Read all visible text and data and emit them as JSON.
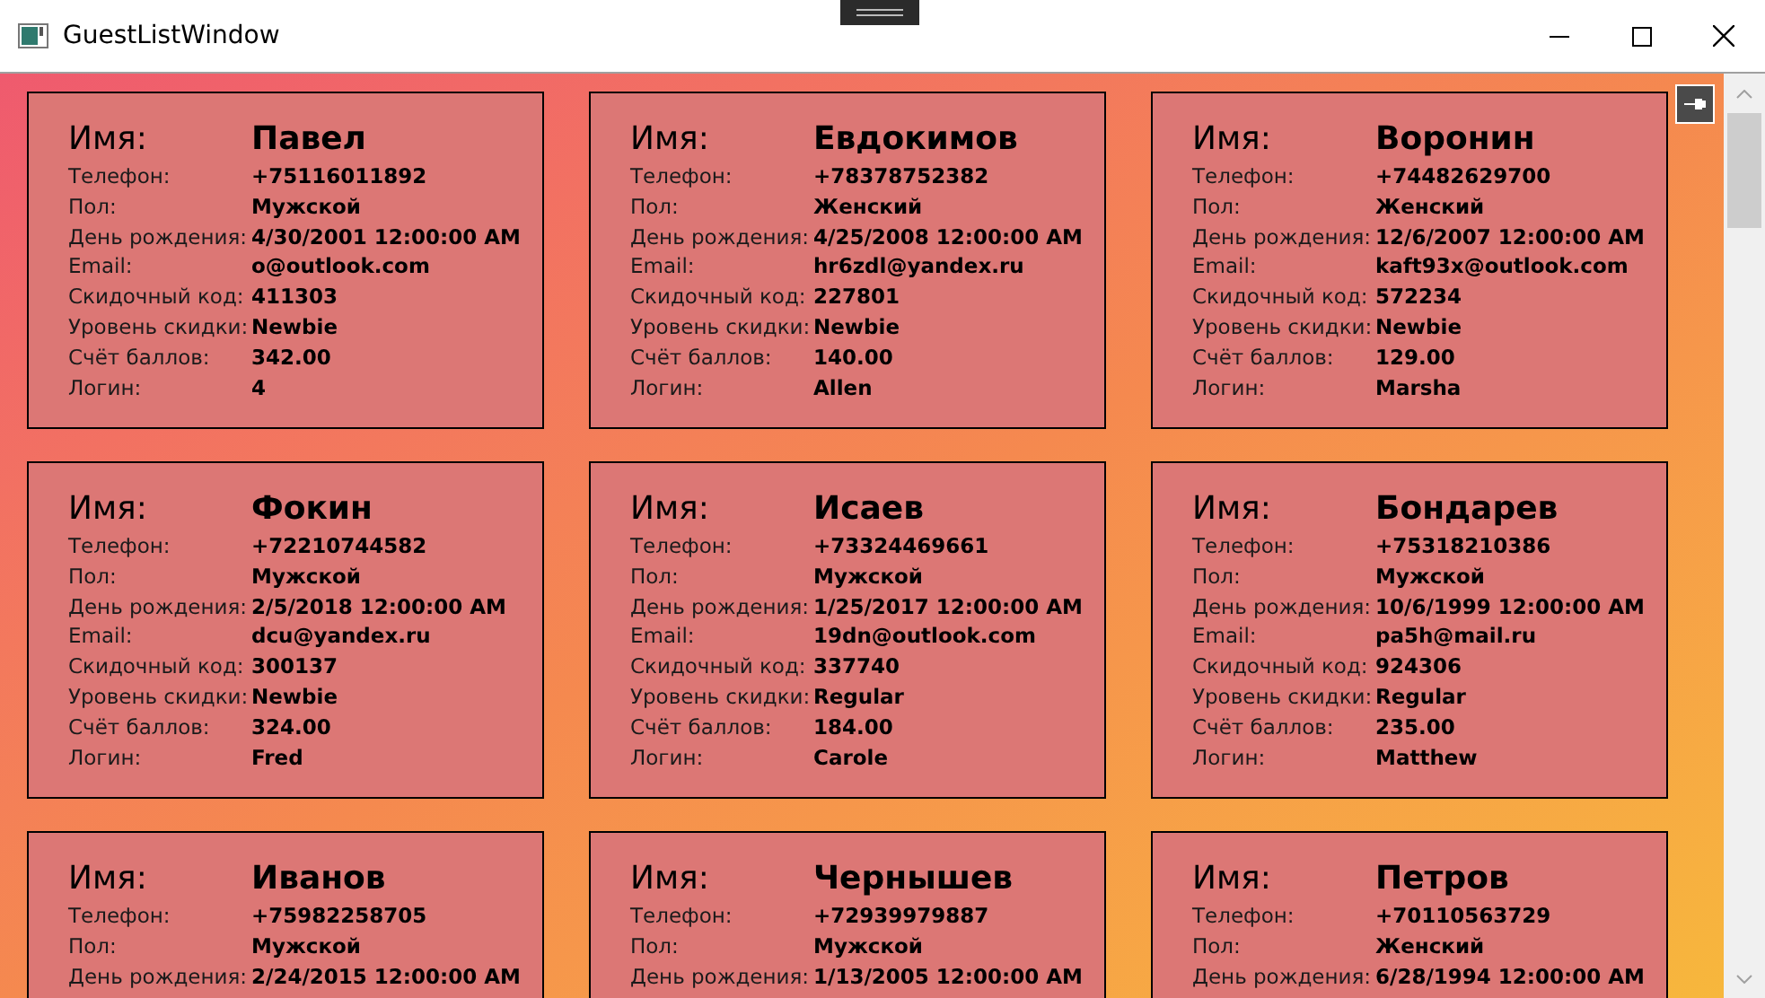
{
  "window": {
    "title": "GuestListWindow"
  },
  "cards": [
    {
      "name_label": "Имя:",
      "name": "Павел",
      "fields": [
        {
          "label": "Телефон:",
          "value": "+75116011892"
        },
        {
          "label": "Пол:",
          "value": "Мужской"
        },
        {
          "label": "День рождения:",
          "value": "4/30/2001 12:00:00 AM"
        },
        {
          "label": "Email:",
          "value": "o@outlook.com"
        },
        {
          "label": "Скидочный код:",
          "value": "411303"
        },
        {
          "label": "Уровень скидки:",
          "value": "Newbie"
        },
        {
          "label": "Счёт баллов:",
          "value": "342.00"
        },
        {
          "label": "Логин:",
          "value": "4"
        }
      ]
    },
    {
      "name_label": "Имя:",
      "name": "Евдокимов",
      "fields": [
        {
          "label": "Телефон:",
          "value": "+78378752382"
        },
        {
          "label": "Пол:",
          "value": "Женский"
        },
        {
          "label": "День рождения:",
          "value": "4/25/2008 12:00:00 AM"
        },
        {
          "label": "Email:",
          "value": "hr6zdl@yandex.ru"
        },
        {
          "label": "Скидочный код:",
          "value": "227801"
        },
        {
          "label": "Уровень скидки:",
          "value": "Newbie"
        },
        {
          "label": "Счёт баллов:",
          "value": "140.00"
        },
        {
          "label": "Логин:",
          "value": "Allen"
        }
      ]
    },
    {
      "name_label": "Имя:",
      "name": "Воронин",
      "fields": [
        {
          "label": "Телефон:",
          "value": "+74482629700"
        },
        {
          "label": "Пол:",
          "value": "Женский"
        },
        {
          "label": "День рождения:",
          "value": "12/6/2007 12:00:00 AM"
        },
        {
          "label": "Email:",
          "value": "kaft93x@outlook.com"
        },
        {
          "label": "Скидочный код:",
          "value": "572234"
        },
        {
          "label": "Уровень скидки:",
          "value": "Newbie"
        },
        {
          "label": "Счёт баллов:",
          "value": "129.00"
        },
        {
          "label": "Логин:",
          "value": "Marsha"
        }
      ]
    },
    {
      "name_label": "Имя:",
      "name": "Фокин",
      "fields": [
        {
          "label": "Телефон:",
          "value": "+72210744582"
        },
        {
          "label": "Пол:",
          "value": "Мужской"
        },
        {
          "label": "День рождения:",
          "value": "2/5/2018 12:00:00 AM"
        },
        {
          "label": "Email:",
          "value": "dcu@yandex.ru"
        },
        {
          "label": "Скидочный код:",
          "value": "300137"
        },
        {
          "label": "Уровень скидки:",
          "value": "Newbie"
        },
        {
          "label": "Счёт баллов:",
          "value": "324.00"
        },
        {
          "label": "Логин:",
          "value": "Fred"
        }
      ]
    },
    {
      "name_label": "Имя:",
      "name": "Исаев",
      "fields": [
        {
          "label": "Телефон:",
          "value": "+73324469661"
        },
        {
          "label": "Пол:",
          "value": "Мужской"
        },
        {
          "label": "День рождения:",
          "value": "1/25/2017 12:00:00 AM"
        },
        {
          "label": "Email:",
          "value": "19dn@outlook.com"
        },
        {
          "label": "Скидочный код:",
          "value": "337740"
        },
        {
          "label": "Уровень скидки:",
          "value": "Regular"
        },
        {
          "label": "Счёт баллов:",
          "value": "184.00"
        },
        {
          "label": "Логин:",
          "value": "Carole"
        }
      ]
    },
    {
      "name_label": "Имя:",
      "name": "Бондарев",
      "fields": [
        {
          "label": "Телефон:",
          "value": "+75318210386"
        },
        {
          "label": "Пол:",
          "value": "Мужской"
        },
        {
          "label": "День рождения:",
          "value": "10/6/1999 12:00:00 AM"
        },
        {
          "label": "Email:",
          "value": "pa5h@mail.ru"
        },
        {
          "label": "Скидочный код:",
          "value": "924306"
        },
        {
          "label": "Уровень скидки:",
          "value": "Regular"
        },
        {
          "label": "Счёт баллов:",
          "value": "235.00"
        },
        {
          "label": "Логин:",
          "value": "Matthew"
        }
      ]
    },
    {
      "name_label": "Имя:",
      "name": "Иванов",
      "fields": [
        {
          "label": "Телефон:",
          "value": "+75982258705"
        },
        {
          "label": "Пол:",
          "value": "Мужской"
        },
        {
          "label": "День рождения:",
          "value": "2/24/2015 12:00:00 AM"
        }
      ]
    },
    {
      "name_label": "Имя:",
      "name": "Чернышев",
      "fields": [
        {
          "label": "Телефон:",
          "value": "+72939979887"
        },
        {
          "label": "Пол:",
          "value": "Мужской"
        },
        {
          "label": "День рождения:",
          "value": "1/13/2005 12:00:00 AM"
        }
      ]
    },
    {
      "name_label": "Имя:",
      "name": "Петров",
      "fields": [
        {
          "label": "Телефон:",
          "value": "+70110563729"
        },
        {
          "label": "Пол:",
          "value": "Женский"
        },
        {
          "label": "День рождения:",
          "value": "6/28/1994 12:00:00 AM"
        }
      ]
    }
  ]
}
